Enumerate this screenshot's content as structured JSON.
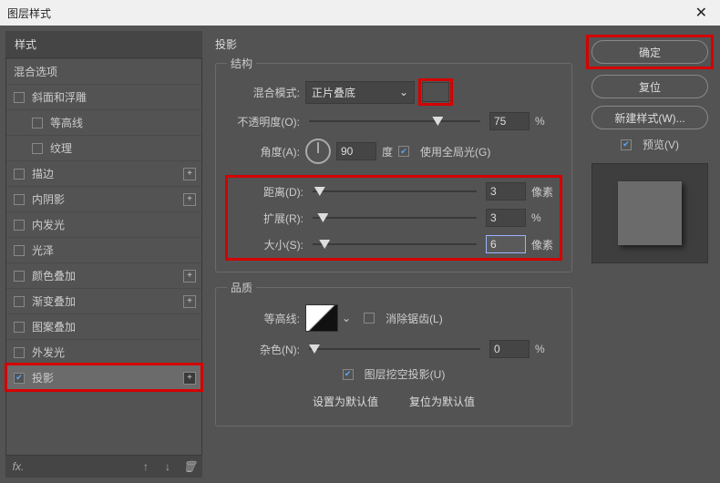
{
  "title": "图层样式",
  "sidebar": {
    "header": "样式",
    "blend_opts": "混合选项",
    "items": [
      {
        "label": "斜面和浮雕",
        "checked": false,
        "plus": false,
        "sub": false
      },
      {
        "label": "等高线",
        "checked": false,
        "plus": false,
        "sub": true
      },
      {
        "label": "纹理",
        "checked": false,
        "plus": false,
        "sub": true
      },
      {
        "label": "描边",
        "checked": false,
        "plus": true,
        "sub": false
      },
      {
        "label": "内阴影",
        "checked": false,
        "plus": true,
        "sub": false
      },
      {
        "label": "内发光",
        "checked": false,
        "plus": false,
        "sub": false
      },
      {
        "label": "光泽",
        "checked": false,
        "plus": false,
        "sub": false
      },
      {
        "label": "颜色叠加",
        "checked": false,
        "plus": true,
        "sub": false
      },
      {
        "label": "渐变叠加",
        "checked": false,
        "plus": true,
        "sub": false
      },
      {
        "label": "图案叠加",
        "checked": false,
        "plus": false,
        "sub": false
      },
      {
        "label": "外发光",
        "checked": false,
        "plus": false,
        "sub": false
      },
      {
        "label": "投影",
        "checked": true,
        "plus": true,
        "sub": false,
        "selected": true
      }
    ]
  },
  "panel": {
    "title": "投影",
    "structure": {
      "legend": "结构",
      "blend_mode_label": "混合模式:",
      "blend_mode_value": "正片叠底",
      "opacity_label": "不透明度(O):",
      "opacity_value": "75",
      "opacity_unit": "%",
      "angle_label": "角度(A):",
      "angle_value": "90",
      "angle_unit": "度",
      "use_global_label": "使用全局光(G)",
      "use_global_checked": true,
      "distance_label": "距离(D):",
      "distance_value": "3",
      "distance_unit": "像素",
      "spread_label": "扩展(R):",
      "spread_value": "3",
      "spread_unit": "%",
      "size_label": "大小(S):",
      "size_value": "6",
      "size_unit": "像素"
    },
    "quality": {
      "legend": "品质",
      "contour_label": "等高线:",
      "antialias_label": "消除锯齿(L)",
      "antialias_checked": false,
      "noise_label": "杂色(N):",
      "noise_value": "0",
      "noise_unit": "%"
    },
    "knockout": {
      "label": "图层挖空投影(U)",
      "checked": true
    },
    "make_default": "设置为默认值",
    "reset_default": "复位为默认值"
  },
  "buttons": {
    "ok": "确定",
    "reset": "复位",
    "new_style": "新建样式(W)...",
    "preview_label": "预览(V)",
    "preview_checked": true
  }
}
